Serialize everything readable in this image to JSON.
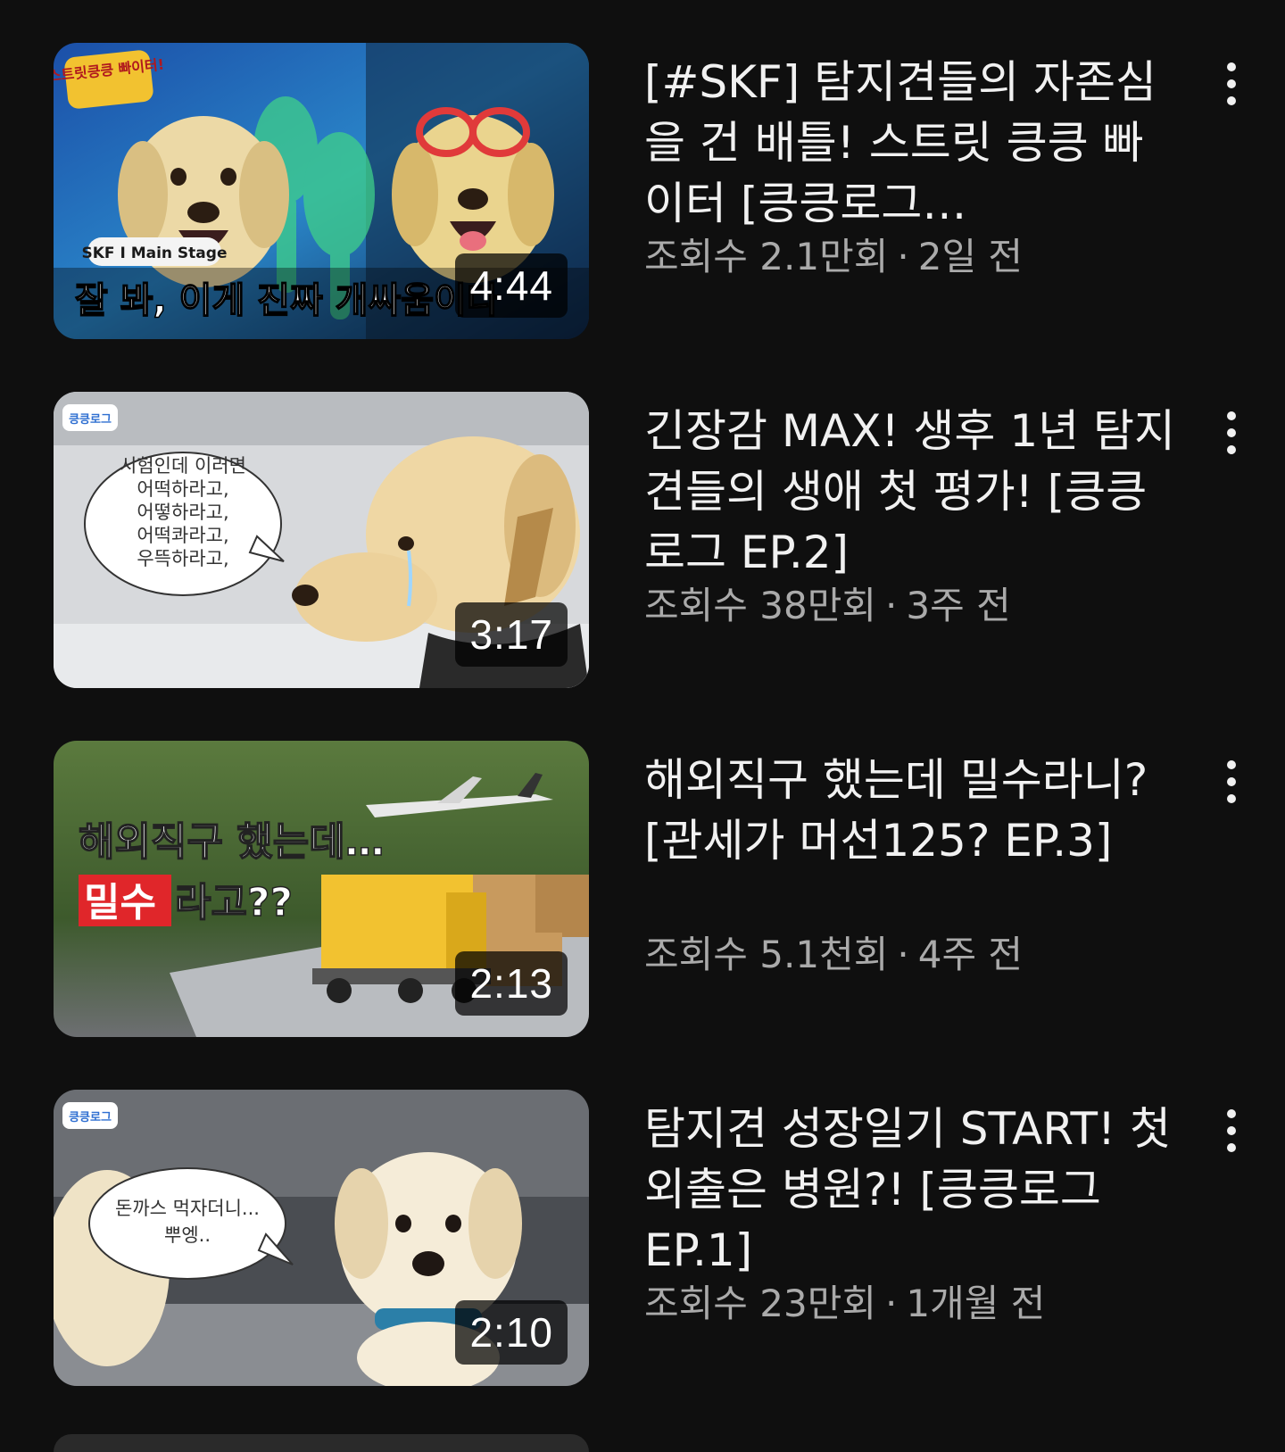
{
  "videos": [
    {
      "title": "[#SKF] 탐지견들의 자존심을 건 배틀! 스트릿 킁킁 빠이터 [킁킁로그…",
      "views": "조회수 2.1만회",
      "age": "2일 전",
      "duration": "4:44",
      "thumbnail": {
        "logo": "스트릿킁킁 빠이터!",
        "badge": "SKF I Main Stage",
        "caption": "잘 봐, 이게 진짜 개싸움이다"
      }
    },
    {
      "title": "긴장감 MAX! 생후 1년 탐지견들의 생애 첫 평가! [킁킁로그 EP.2]",
      "views": "조회수 38만회",
      "age": "3주 전",
      "duration": "3:17",
      "thumbnail": {
        "logo": "킁킁로그",
        "speech_lines": [
          "시험인데 이러면",
          "어떡하라고,",
          "어떻하라고,",
          "어떡콰라고,",
          "우뜩하라고,"
        ]
      }
    },
    {
      "title": "해외직구 했는데 밀수라니? [관세가 머선125? EP.3]",
      "views": "조회수 5.1천회",
      "age": "4주 전",
      "duration": "2:13",
      "thumbnail": {
        "line1": "해외직구 했는데…",
        "highlight": "밀수",
        "line2_rest": "라고??"
      }
    },
    {
      "title": "탐지견 성장일기 START! 첫 외출은 병원?! [킁킁로그 EP.1]",
      "views": "조회수 23만회",
      "age": "1개월 전",
      "duration": "2:10",
      "thumbnail": {
        "logo": "킁킁로그",
        "speech_lines": [
          "돈까스 먹자더니...",
          "뿌엥.."
        ]
      }
    }
  ],
  "meta_separator": "·",
  "icons": {
    "more": "more-vertical-icon"
  },
  "colors": {
    "background": "#0f0f0f",
    "title": "#f1f1f1",
    "meta": "#aaaaaa",
    "duration_bg": "rgba(0,0,0,0.72)",
    "highlight_red": "#e0262a"
  }
}
